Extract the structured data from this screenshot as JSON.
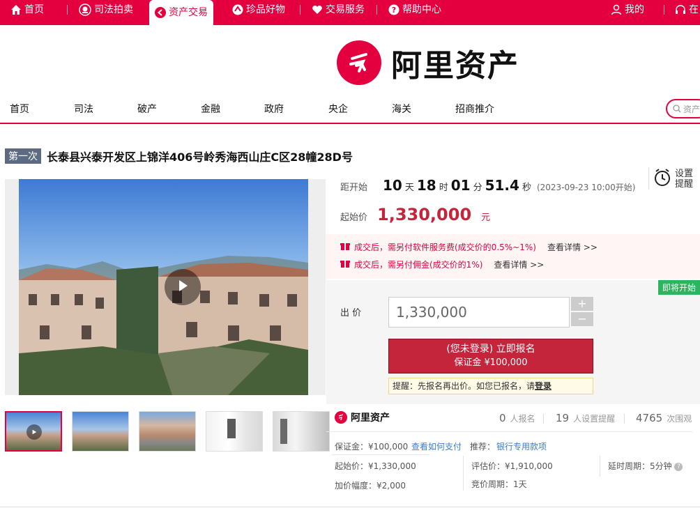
{
  "topnav": {
    "items": [
      {
        "label": "首页",
        "icon": "home-icon"
      },
      {
        "label": "司法拍卖",
        "icon": "court-emblem-icon"
      },
      {
        "label": "资产交易",
        "icon": "asset-icon"
      },
      {
        "label": "珍品好物",
        "icon": "gem-icon"
      },
      {
        "label": "交易服务",
        "icon": "heart-icon"
      },
      {
        "label": "帮助中心",
        "icon": "help-icon"
      }
    ],
    "my": "我的",
    "more": "在"
  },
  "brand": {
    "name": "阿里资产"
  },
  "catnav": [
    "首页",
    "司法",
    "破产",
    "金融",
    "政府",
    "央企",
    "海关",
    "招商推介"
  ],
  "search": {
    "placeholder": "资产"
  },
  "item": {
    "round": "第一次",
    "title": "长泰县兴泰开发区上锦洋406号岭秀海西山庄C区28幢28D号"
  },
  "countdown": {
    "label": "距开始",
    "days": "10",
    "days_unit": "天",
    "hours": "18",
    "hours_unit": "时",
    "minutes": "01",
    "minutes_unit": "分",
    "seconds": "51.4",
    "seconds_unit": "秒",
    "start_note": "(2023-09-23 10:00开始)"
  },
  "reminder": {
    "line1": "设置",
    "line2": "提醒"
  },
  "start_price": {
    "label": "起始价",
    "value": "1,330,000",
    "unit": "元"
  },
  "notices": [
    {
      "text": "成交后，需另付软件服务费(成交价的0.5%~1%)",
      "link": "查看详情 >>"
    },
    {
      "text": "成交后，需另付佣金(成交价的1%)",
      "link": "查看详情 >>"
    }
  ],
  "bid": {
    "status": "即将开始",
    "label": "出 价",
    "value": "1,330,000",
    "plus": "+",
    "minus": "−",
    "register_line1": "(您未登录) 立即报名",
    "register_line2": "保证金 ¥100,000",
    "tip": "提醒：先报名再出价。如您已报名，请",
    "tip_link": "登录"
  },
  "stats": {
    "signups": "0",
    "signups_label": "人报名",
    "reminders": "19",
    "reminders_label": "人设置提醒",
    "views": "4765",
    "views_label": "次围观"
  },
  "details": {
    "deposit": "保证金：¥100,000",
    "how_to_pay": "查看如何支付",
    "recommend": "推荐：",
    "recommend_link": "银行专用款项",
    "start_price": "起始价：¥1,330,000",
    "appraisal": "评估价：¥1,910,000",
    "delay": "延时周期：5分钟",
    "increment": "加价幅度：¥2,000",
    "cycle": "竞价周期：1天"
  },
  "colors": {
    "brand": "#e4003f",
    "button": "#c4253b",
    "status": "#2db55d"
  }
}
